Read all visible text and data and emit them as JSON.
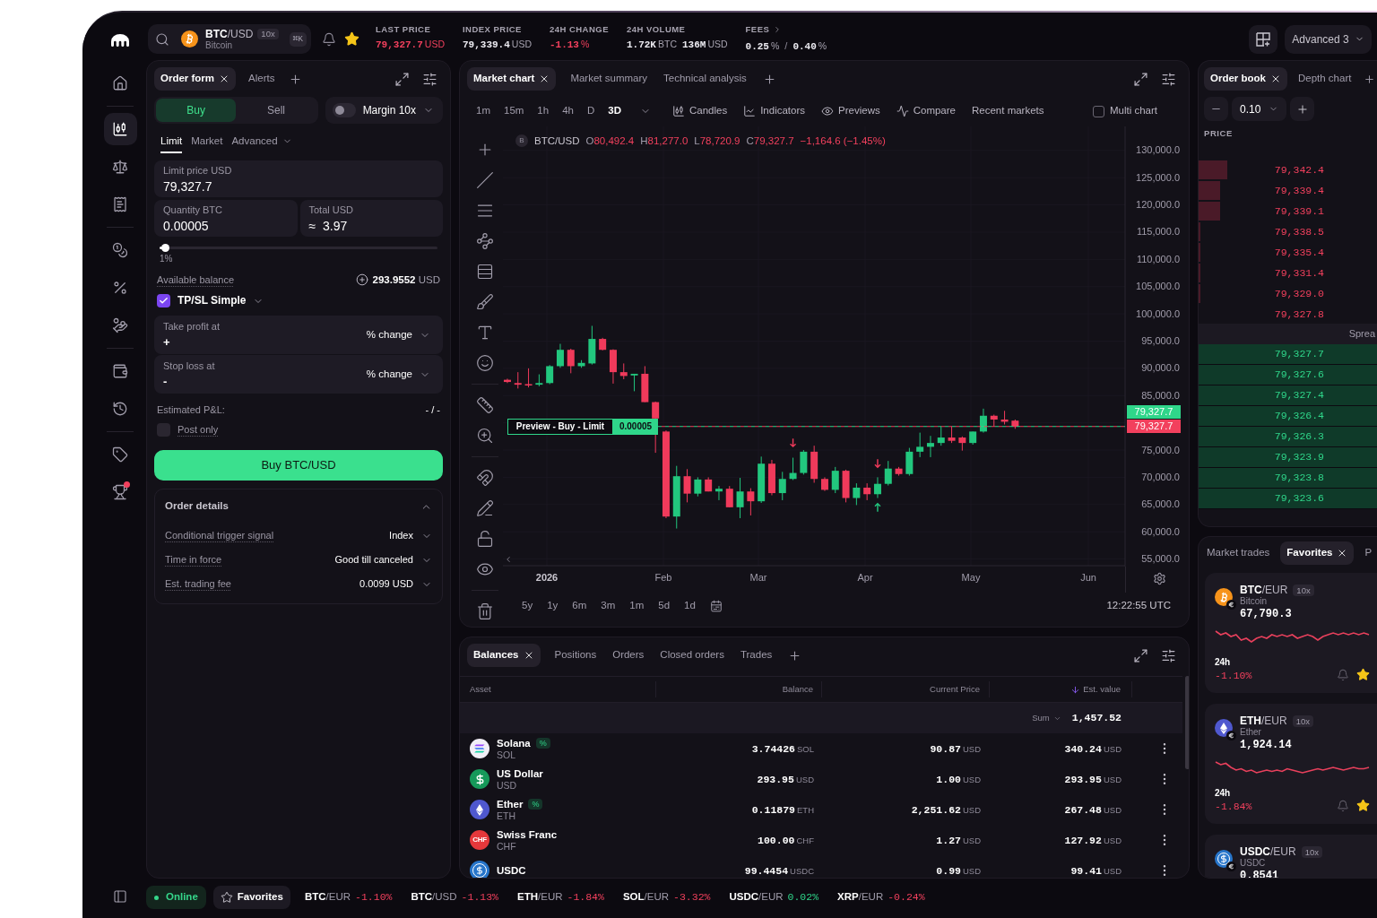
{
  "sidebar": {
    "groups": [
      {
        "items": [
          {
            "selected": false,
            "badge": false
          }
        ]
      },
      {
        "items": [
          {
            "selected": true,
            "badge": false
          },
          {
            "selected": false,
            "badge": false
          },
          {
            "selected": false,
            "badge": false
          }
        ]
      },
      {
        "items": [
          {
            "selected": false,
            "badge": false
          },
          {
            "selected": false,
            "badge": false
          },
          {
            "selected": false,
            "badge": false
          }
        ]
      },
      {
        "items": [
          {
            "selected": false,
            "badge": false
          },
          {
            "selected": false,
            "badge": false
          }
        ]
      },
      {
        "items": [
          {
            "selected": false,
            "badge": false
          },
          {
            "selected": false,
            "badge": true
          }
        ]
      }
    ]
  },
  "top_bar": {
    "market": {
      "base": "BTC",
      "quote": "/USD",
      "leverage": "10x",
      "name": "Bitcoin",
      "shortcut": "⌘K",
      "favorite": true
    },
    "stats": [
      {
        "label": "LAST PRICE",
        "link": false,
        "values": [
          {
            "value": "79,327.7",
            "unit": "USD",
            "negative": true
          }
        ]
      },
      {
        "label": "INDEX PRICE",
        "link": false,
        "values": [
          {
            "value": "79,339.4",
            "unit": "USD",
            "negative": false
          }
        ]
      },
      {
        "label": "24H CHANGE",
        "link": false,
        "values": [
          {
            "value": "-1.13",
            "unit": "%",
            "negative": true
          }
        ]
      },
      {
        "label": "24H VOLUME",
        "link": false,
        "values": [
          {
            "value": "1.72K",
            "unit": "BTC",
            "negative": false
          },
          {
            "value": "136M",
            "unit": "USD",
            "negative": false
          }
        ]
      },
      {
        "label": "FEES",
        "link": true,
        "separator": "/",
        "values": [
          {
            "value": "0.25",
            "unit": "%",
            "negative": false
          },
          {
            "value": "0.40",
            "unit": "%",
            "negative": false
          }
        ]
      }
    ],
    "layout_menu": "Advanced 3"
  },
  "order_form": {
    "tabs": [
      {
        "label": "Order form",
        "selected": true
      },
      {
        "label": "Alerts",
        "selected": false
      }
    ],
    "sides": [
      {
        "label": "Buy",
        "selected": true
      },
      {
        "label": "Sell",
        "selected": false
      }
    ],
    "margin": {
      "label": "Margin 10x",
      "on": false
    },
    "order_types": [
      {
        "label": "Limit",
        "selected": true,
        "dropdown": false
      },
      {
        "label": "Market",
        "selected": false,
        "dropdown": false
      },
      {
        "label": "Advanced",
        "selected": false,
        "dropdown": true
      }
    ],
    "limit_price": {
      "label": "Limit price USD",
      "value": "79,327.7"
    },
    "quantity": {
      "label": "Quantity BTC",
      "value": "0.00005"
    },
    "total": {
      "label": "Total USD",
      "prefix": "≈",
      "value": "3.97"
    },
    "slider": {
      "level": 0.01,
      "reading": "1%"
    },
    "available_balance": {
      "label": "Available balance",
      "value": "293.9552",
      "unit": "USD"
    },
    "tpsl": {
      "label": "TP/SL Simple",
      "checked": true
    },
    "take_profit": {
      "label": "Take profit at",
      "value": "+",
      "mode": "% change"
    },
    "stop_loss": {
      "label": "Stop loss at",
      "value": "-",
      "mode": "% change"
    },
    "estimated_pnl": {
      "label": "Estimated P&L:",
      "value": "- / -"
    },
    "post_only": {
      "label": "Post only",
      "checked": false
    },
    "submit": "Buy BTC/USD",
    "details": {
      "title": "Order details",
      "expanded": true,
      "rows": [
        {
          "label": "Conditional trigger signal",
          "value": "Index"
        },
        {
          "label": "Time in force",
          "value": "Good till canceled"
        },
        {
          "label": "Est. trading fee",
          "value": "0.0099 USD"
        }
      ]
    }
  },
  "chart_panel": {
    "tabs": [
      {
        "label": "Market chart",
        "selected": true
      },
      {
        "label": "Market summary",
        "selected": false
      },
      {
        "label": "Technical analysis",
        "selected": false
      }
    ],
    "intervals": [
      {
        "label": "1m",
        "selected": false
      },
      {
        "label": "15m",
        "selected": false
      },
      {
        "label": "1h",
        "selected": false
      },
      {
        "label": "4h",
        "selected": false
      },
      {
        "label": "D",
        "selected": false
      },
      {
        "label": "3D",
        "selected": true
      }
    ],
    "tools": [
      {
        "label": "Candles"
      },
      {
        "label": "Indicators"
      },
      {
        "label": "Previews"
      },
      {
        "label": "Compare"
      },
      {
        "label": "Recent markets"
      }
    ],
    "multi_chart": {
      "label": "Multi chart",
      "checked": false
    },
    "symbol_badge": "B",
    "symbol": "BTC/USD",
    "ohlc": [
      {
        "key": "O",
        "value": "80,492.4"
      },
      {
        "key": "H",
        "value": "81,277.0"
      },
      {
        "key": "L",
        "value": "78,720.9"
      },
      {
        "key": "C",
        "value": "79,327.7"
      }
    ],
    "change": "−1,164.6 (−1.45%)",
    "y_axis_labels": [
      "130,000.0",
      "125,000.0",
      "120,000.0",
      "115,000.0",
      "110,000.0",
      "105,000.0",
      "100,000.0",
      "95,000.0",
      "90,000.0",
      "85,000.0",
      "75,000.0",
      "70,000.0",
      "65,000.0",
      "60,000.0",
      "55,000.0"
    ],
    "x_axis_labels": [
      "2026",
      "Feb",
      "Mar",
      "Apr",
      "May",
      "Jun"
    ],
    "price_tags": [
      {
        "label": "79,327.7",
        "color": "#2fd68a"
      },
      {
        "label": "79,327.7",
        "color": "#f2405d"
      }
    ],
    "order_preview": {
      "label": "Preview - Buy - Limit",
      "quantity": "0.00005"
    },
    "ranges": [
      "5y",
      "1y",
      "6m",
      "3m",
      "1m",
      "5d",
      "1d"
    ],
    "clock": "12:22:55 UTC"
  },
  "balances": {
    "tabs": [
      {
        "label": "Balances",
        "selected": true
      },
      {
        "label": "Positions",
        "selected": false
      },
      {
        "label": "Orders",
        "selected": false
      },
      {
        "label": "Closed orders",
        "selected": false
      },
      {
        "label": "Trades",
        "selected": false
      }
    ],
    "columns": [
      {
        "label": "Asset",
        "sorted": false
      },
      {
        "label": "Balance",
        "sorted": false
      },
      {
        "label": "Current Price",
        "sorted": false
      },
      {
        "label": "Est. value",
        "sorted": true
      }
    ],
    "sum": {
      "label": "Sum",
      "value": "1,457.52"
    },
    "rows": [
      {
        "name": "Solana",
        "symbol": "SOL",
        "badge": "%",
        "balance": {
          "value": "3.74426",
          "unit": "SOL"
        },
        "price": {
          "value": "90.87",
          "unit": "USD"
        },
        "est_value": {
          "value": "340.24",
          "unit": "USD"
        }
      },
      {
        "name": "US Dollar",
        "symbol": "USD",
        "balance": {
          "value": "293.95",
          "unit": "USD"
        },
        "price": {
          "value": "1.00",
          "unit": "USD"
        },
        "est_value": {
          "value": "293.95",
          "unit": "USD"
        }
      },
      {
        "name": "Ether",
        "symbol": "ETH",
        "badge": "%",
        "balance": {
          "value": "0.11879",
          "unit": "ETH"
        },
        "price": {
          "value": "2,251.62",
          "unit": "USD"
        },
        "est_value": {
          "value": "267.48",
          "unit": "USD"
        }
      },
      {
        "name": "Swiss Franc",
        "symbol": "CHF",
        "logo_text": "CHF",
        "balance": {
          "value": "100.00",
          "unit": "CHF"
        },
        "price": {
          "value": "1.27",
          "unit": "USD"
        },
        "est_value": {
          "value": "127.92",
          "unit": "USD"
        }
      },
      {
        "name": "USDC",
        "balance": {
          "value": "99.4454",
          "unit": "USDC"
        },
        "price": {
          "value": "0.99",
          "unit": "USD"
        },
        "est_value": {
          "value": "99.41",
          "unit": "USD"
        }
      }
    ]
  },
  "order_book": {
    "tabs": [
      {
        "label": "Order book",
        "selected": true
      },
      {
        "label": "Depth chart",
        "selected": false
      }
    ],
    "tick_size": "0.10",
    "column": "PRICE",
    "asks": [
      {
        "price": "79,342.4",
        "level": 0.16
      },
      {
        "price": "79,339.4",
        "level": 0.12
      },
      {
        "price": "79,339.1",
        "level": 0.12
      },
      {
        "price": "79,338.5",
        "level": 0.01
      },
      {
        "price": "79,335.4",
        "level": 0.01
      },
      {
        "price": "79,331.4",
        "level": 0.01
      },
      {
        "price": "79,329.0",
        "level": 0.01
      },
      {
        "price": "79,327.8"
      }
    ],
    "spread_label": "Sprea",
    "bids": [
      {
        "price": "79,327.7",
        "level": 1
      },
      {
        "price": "79,327.6",
        "level": 1
      },
      {
        "price": "79,327.4",
        "level": 1
      },
      {
        "price": "79,326.4",
        "level": 1
      },
      {
        "price": "79,326.3",
        "level": 1
      },
      {
        "price": "79,323.9",
        "level": 1
      },
      {
        "price": "79,323.8",
        "level": 1
      },
      {
        "price": "79,323.6",
        "level": 1
      }
    ]
  },
  "favorites": {
    "tabs": [
      {
        "label": "Market trades",
        "selected": false
      },
      {
        "label": "Favorites",
        "selected": true
      },
      {
        "label": "P",
        "selected": false
      }
    ],
    "cards": [
      {
        "base": "BTC",
        "quote": "/EUR",
        "leverage": "10x",
        "name": "Bitcoin",
        "price": "67,790.3",
        "period": "24h",
        "change": "-1.10%",
        "negative": true,
        "favorite": true
      },
      {
        "base": "ETH",
        "quote": "/EUR",
        "leverage": "10x",
        "name": "Ether",
        "price": "1,924.14",
        "period": "24h",
        "change": "-1.84%",
        "negative": true,
        "favorite": true
      },
      {
        "base": "USDC",
        "quote": "/EUR",
        "leverage": "10x",
        "name": "USDC",
        "price": "0.8541"
      }
    ]
  },
  "status_bar": {
    "connection": {
      "label": "Online",
      "online": true
    },
    "favorites_button": "Favorites",
    "tickers": [
      {
        "base": "BTC",
        "quote": "/EUR",
        "change": "-1.10%",
        "negative": true
      },
      {
        "base": "BTC",
        "quote": "/USD",
        "change": "-1.13%",
        "negative": true
      },
      {
        "base": "ETH",
        "quote": "/EUR",
        "change": "-1.84%",
        "negative": true
      },
      {
        "base": "SOL",
        "quote": "/EUR",
        "change": "-3.32%",
        "negative": true
      },
      {
        "base": "USDC",
        "quote": "/EUR",
        "change": "0.02%",
        "negative": false
      },
      {
        "base": "XRP",
        "quote": "/EUR",
        "change": "-0.24%",
        "negative": true
      }
    ]
  }
}
